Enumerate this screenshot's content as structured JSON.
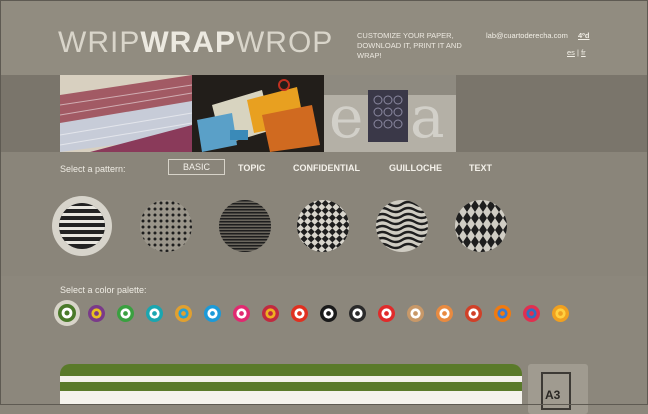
{
  "header": {
    "logo_light1": "WRIP",
    "logo_bold": "WRAP",
    "logo_light2": "WROP",
    "tagline": "CUSTOMIZE YOUR PAPER, DOWNLOAD IT, PRINT IT AND WRAP!",
    "email": "lab@cuartoderecha.com",
    "lab_link": "4ºd",
    "lang_es": "es",
    "lang_sep": "|",
    "lang_fr": "fr"
  },
  "patterns": {
    "label": "Select a pattern:",
    "tabs": [
      {
        "label": "BASIC",
        "active": true
      },
      {
        "label": "TOPIC",
        "active": false
      },
      {
        "label": "CONFIDENTIAL",
        "active": false
      },
      {
        "label": "GUILLOCHE",
        "active": false
      },
      {
        "label": "TEXT",
        "active": false
      }
    ],
    "items": [
      "stripes",
      "polka-dots",
      "fine-lines",
      "checkerboard",
      "waves",
      "diamonds"
    ],
    "selected": "stripes"
  },
  "palettes": {
    "label": "Select a color palette:",
    "items": [
      {
        "outer": "#4a7a2a",
        "inner": "#ffffff"
      },
      {
        "outer": "#7a3a8a",
        "inner": "#e8c020"
      },
      {
        "outer": "#3aa040",
        "inner": "#ffffff"
      },
      {
        "outer": "#1aa6b0",
        "inner": "#ffffff"
      },
      {
        "outer": "#e0a030",
        "inner": "#2aa0d0"
      },
      {
        "outer": "#1c9ad8",
        "inner": "#ffffff"
      },
      {
        "outer": "#e02a70",
        "inner": "#ffffff"
      },
      {
        "outer": "#c02a40",
        "inner": "#f0b020"
      },
      {
        "outer": "#e03020",
        "inner": "#ffffff"
      },
      {
        "outer": "#1a1a1a",
        "inner": "#ffffff"
      },
      {
        "outer": "#2a2a2a",
        "inner": "#ffffff"
      },
      {
        "outer": "#e02a2a",
        "inner": "#ffffff"
      },
      {
        "outer": "#c89868",
        "inner": "#ffffff"
      },
      {
        "outer": "#e88a40",
        "inner": "#ffffff"
      },
      {
        "outer": "#d04028",
        "inner": "#ffffff"
      },
      {
        "outer": "#f07a10",
        "inner": "#3a7ad0"
      },
      {
        "outer": "#e03050",
        "inner": "#3070c0"
      },
      {
        "outer": "#f0a020",
        "inner": "#ffd040"
      }
    ]
  },
  "preview": {
    "size_label": "A3"
  },
  "colors": {
    "stripe_green": "#5a7a2a",
    "stripe_white": "#f4f2ec"
  }
}
